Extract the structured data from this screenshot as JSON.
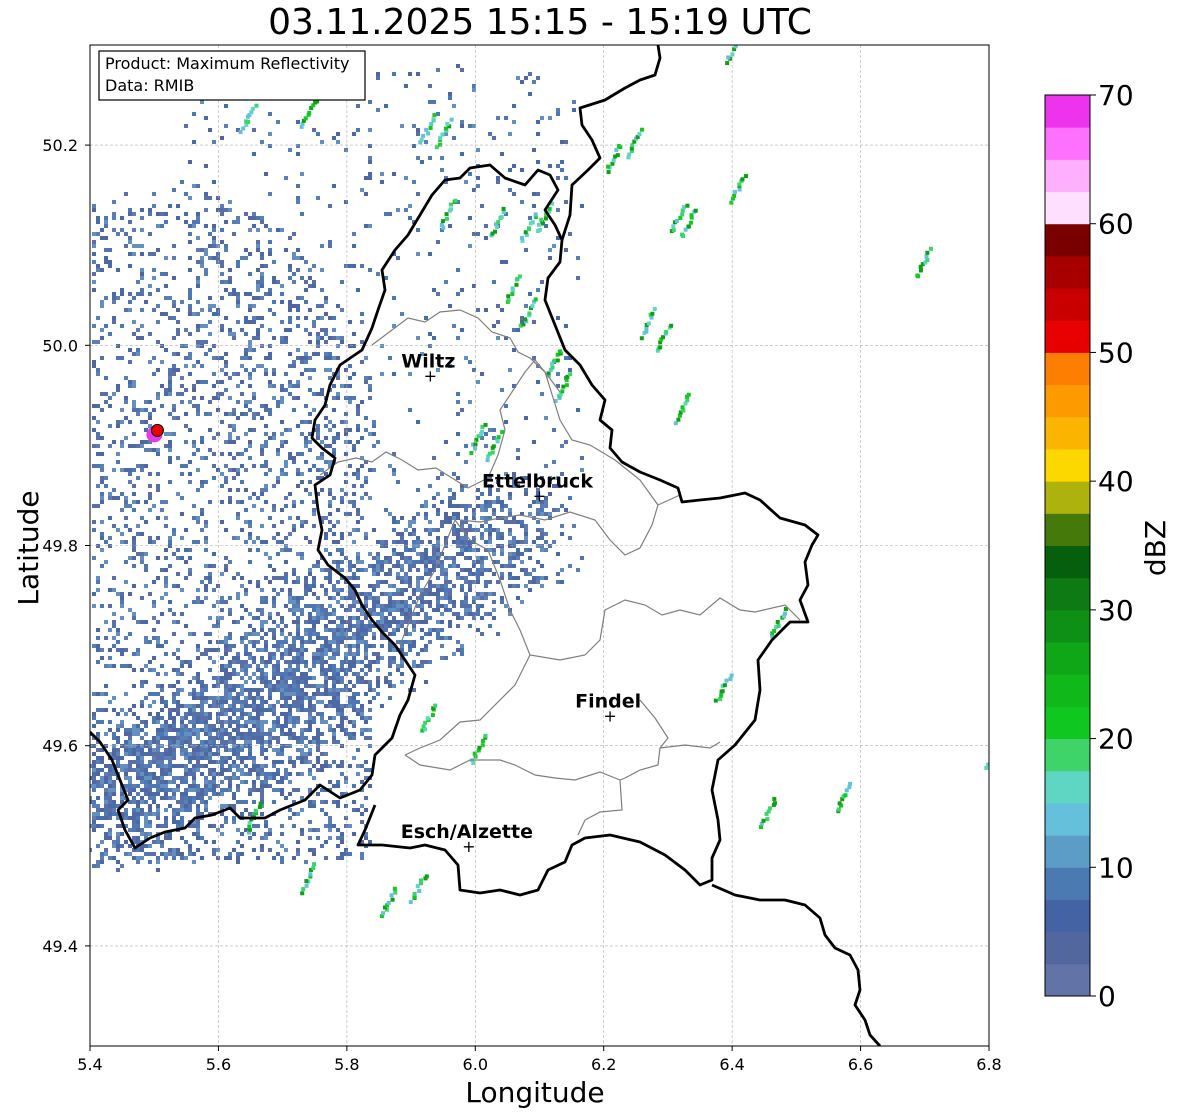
{
  "title": "03.11.2025 15:15 - 15:19 UTC",
  "info_box": {
    "product_line": "Product: Maximum Reflectivity",
    "data_line": "Data: RMIB"
  },
  "axes": {
    "xlabel": "Longitude",
    "ylabel": "Latitude",
    "xlim": [
      5.4,
      6.8
    ],
    "ylim": [
      49.3,
      50.3
    ],
    "x_ticks": [
      "5.4",
      "5.6",
      "5.8",
      "6.0",
      "6.2",
      "6.4",
      "6.6",
      "6.8"
    ],
    "y_ticks": [
      "49.4",
      "49.6",
      "49.8",
      "50.0",
      "50.2"
    ],
    "grid": true
  },
  "colorbar": {
    "label": "dBZ",
    "range": [
      0,
      70
    ],
    "tick_labels": [
      "0",
      "10",
      "20",
      "30",
      "40",
      "50",
      "60",
      "70"
    ],
    "colors": [
      "#6273a8",
      "#53679f",
      "#4463a5",
      "#4b7ab3",
      "#5b9dc7",
      "#65c1db",
      "#5fd6c3",
      "#3ed46a",
      "#10c720",
      "#10b81a",
      "#0fa617",
      "#0d9015",
      "#0e7a14",
      "#065f0c",
      "#457a0a",
      "#aeb20c",
      "#fdd800",
      "#fbb500",
      "#fd9a00",
      "#fd7e00",
      "#e80000",
      "#c80000",
      "#a80000",
      "#7a0000",
      "#fee0fe",
      "#feb0fe",
      "#fe70fe",
      "#ee33ee"
    ]
  },
  "cities": [
    {
      "name": "Wiltz",
      "lon": 5.93,
      "lat": 49.97
    },
    {
      "name": "Ettelbruck",
      "lon": 6.1,
      "lat": 49.85
    },
    {
      "name": "Findel",
      "lon": 6.21,
      "lat": 49.63
    },
    {
      "name": "Esch/Alzette",
      "lon": 5.99,
      "lat": 49.5
    }
  ],
  "radar_site": {
    "lon": 5.505,
    "lat": 49.915
  }
}
